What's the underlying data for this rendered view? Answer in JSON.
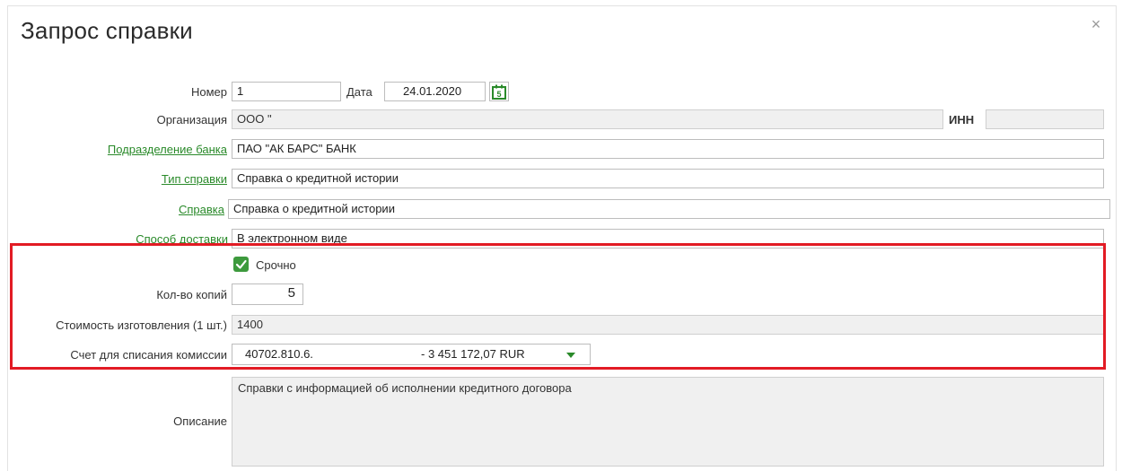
{
  "dialog": {
    "title": "Запрос справки",
    "close_glyph": "×"
  },
  "form": {
    "number_label": "Номер",
    "number_value": "1",
    "date_label": "Дата",
    "date_value": "24.01.2020",
    "org_label": "Организация",
    "org_value": "ООО \"",
    "inn_label": "ИНН",
    "inn_value": "",
    "bank_branch_label": "Подразделение банка",
    "bank_branch_value": "ПАО \"АК БАРС\" БАНК",
    "cert_type_label": "Тип справки",
    "cert_type_value": "Справка о кредитной истории",
    "cert_label": "Справка",
    "cert_value": "Справка о кредитной истории",
    "delivery_label": "Способ доставки",
    "delivery_value": "В электронном виде",
    "urgent_label": "Срочно",
    "urgent_checked": true,
    "copies_label": "Кол-во копий",
    "copies_value": "5",
    "cost_label": "Стоимость изготовления (1 шт.)",
    "cost_value": "1400",
    "account_label": "Счет для списания комиссии",
    "account_number": "40702.810.6.",
    "account_balance": "- 3 451 172,07 RUR",
    "description_label": "Описание",
    "description_value": "Справки с информацией об исполнении кредитного договора"
  },
  "icons": {
    "calendar": "calendar-icon",
    "checkbox": "checkmark-icon",
    "dropdown": "triangle-down-icon",
    "close": "close-icon"
  },
  "colors": {
    "link_green": "#2a8a2a",
    "checkbox_green": "#3d9a3d",
    "highlight_red": "#e21b24",
    "readonly_gray": "#f0f0f0"
  }
}
